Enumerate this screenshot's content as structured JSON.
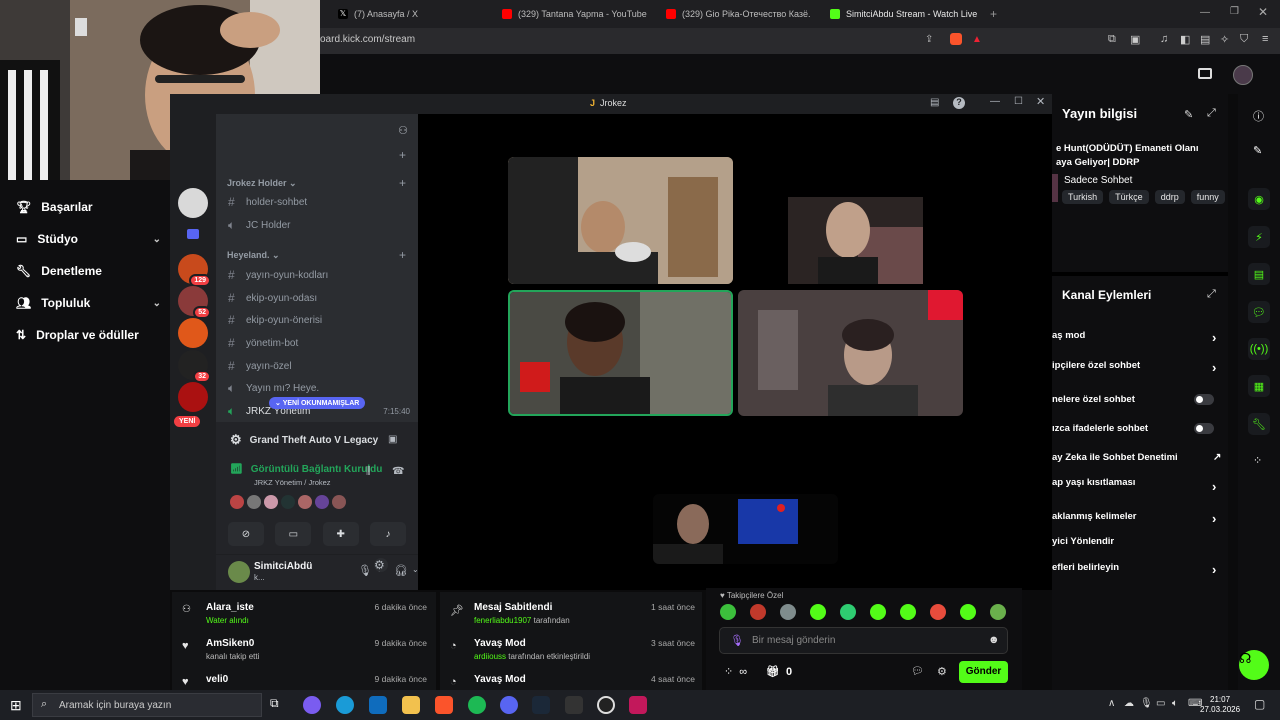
{
  "browser": {
    "tabs": [
      {
        "label": "(7) Anasayfa / X"
      },
      {
        "label": "(329) Tantana Yapma - YouTube"
      },
      {
        "label": "(329) Gio Pika-Отечество Казё..."
      },
      {
        "label": "SimitciAbdu Stream - Watch Live on"
      }
    ],
    "url": "oard.kick.com/stream"
  },
  "left_nav": {
    "items": [
      {
        "label": "Başarılar",
        "icon": "trophy-icon"
      },
      {
        "label": "Stüdyo",
        "icon": "studio-icon"
      },
      {
        "label": "Denetleme",
        "icon": "wrench-icon"
      },
      {
        "label": "Topluluk",
        "icon": "community-icon"
      },
      {
        "label": "Droplar ve ödüller",
        "icon": "drops-icon"
      }
    ]
  },
  "discord": {
    "window_title": "Jrokez",
    "guild_badges": [
      "129",
      "52",
      "32"
    ],
    "new_label": "YENİ",
    "unread_label": "YENİ OKUNMAMIŞLAR",
    "categories": [
      {
        "name": "Jrokez Holder",
        "channels": [
          "holder-sohbet",
          "JC Holder"
        ]
      },
      {
        "name": "Heyeland.",
        "channels": [
          "yayın-oyun-kodları",
          "ekip-oyun-odası",
          "ekip-oyun-önerisi",
          "yönetim-bot",
          "yayın-özel",
          "Yayın mı? Heye."
        ]
      }
    ],
    "active_voice": {
      "name": "JRKZ Yönetim",
      "timer": "7:15:40"
    },
    "activity": "Grand Theft Auto V Legacy",
    "connection_status": "Görüntülü Bağlantı Kuruldu",
    "connection_sub": "JRKZ Yönetim / Jrokez",
    "user": {
      "name": "SimitciAbdü",
      "status": "k..."
    }
  },
  "right_panel": {
    "stream_info_title": "Yayın bilgisi",
    "stream_title": "e Hunt(ODÜDÜT) Emaneti Olanı aya Geliyor| DDRP",
    "category": "Sadece Sohbet",
    "tags": [
      "Turkish",
      "Türkçe",
      "ddrp",
      "funny"
    ],
    "channel_actions_title": "Kanal Eylemleri",
    "actions": [
      {
        "label": "aş mod",
        "control": "arrow"
      },
      {
        "label": "ipçilere özel sohbet",
        "control": "arrow"
      },
      {
        "label": "nelere özel sohbet",
        "control": "toggle"
      },
      {
        "label": "ızca ifadelerle sohbet",
        "control": "toggle"
      },
      {
        "label": "ay Zeka ile Sohbet Denetimi",
        "control": "external"
      },
      {
        "label": "ap yaşı kısıtlaması",
        "control": "arrow"
      },
      {
        "label": "aklanmış kelimeler",
        "control": "arrow"
      },
      {
        "label": "yici Yönlendir",
        "control": "none"
      },
      {
        "label": "efleri belirleyin",
        "control": "arrow"
      }
    ]
  },
  "activity_feed": [
    {
      "name": "Alara_iste",
      "sub": "Water alındı",
      "time": "6 dakika önce"
    },
    {
      "name": "AmSiken0",
      "sub": "kanalı takip etti",
      "time": "9 dakika önce"
    },
    {
      "name": "veli0",
      "sub": "",
      "time": "9 dakika önce"
    }
  ],
  "mod_feed": [
    {
      "name": "Mesaj Sabitlendi",
      "actor": "fenerliabdu1907",
      "sub": " tarafından",
      "time": "1 saat önce"
    },
    {
      "name": "Yavaş Mod",
      "actor": "ardiiouss",
      "sub": " tarafından etkinleştirildi",
      "time": "3 saat önce"
    },
    {
      "name": "Yavaş Mod",
      "actor": "",
      "sub": "",
      "time": "4 saat önce"
    }
  ],
  "chat": {
    "followers_only": "Takipçilere Özel",
    "placeholder": "Bir mesaj gönderin",
    "points": "∞",
    "gifts": "0",
    "send_label": "Gönder"
  },
  "taskbar": {
    "search_placeholder": "Aramak için buraya yazın",
    "time": "21:07",
    "date": "27.03.2026"
  },
  "colors": {
    "kick_green": "#53fc18",
    "discord_bg": "#313338",
    "discord_dark": "#1e1f22",
    "mention_red": "#f23f43"
  }
}
